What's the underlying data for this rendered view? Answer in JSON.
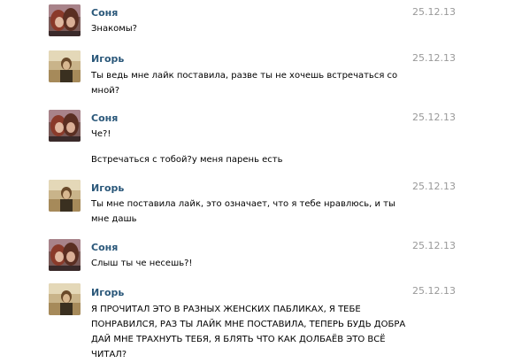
{
  "messages": [
    {
      "sender": "Соня",
      "date": "25.12.13",
      "avatar": "sonya",
      "lines": [
        "Знакомы?"
      ]
    },
    {
      "sender": "Игорь",
      "date": "25.12.13",
      "avatar": "igor",
      "lines": [
        "Ты ведь мне лайк поставила, разве ты не хочешь встречаться со",
        "мной?"
      ]
    },
    {
      "sender": "Соня",
      "date": "25.12.13",
      "avatar": "sonya",
      "lines": [
        "Че?!"
      ],
      "extra_lines": [
        "Встречаться с тобой?у меня парень есть"
      ]
    },
    {
      "sender": "Игорь",
      "date": "25.12.13",
      "avatar": "igor",
      "lines": [
        "Ты мне поставила лайк, это означает, что я тебе нравлюсь, и ты",
        "мне дашь"
      ]
    },
    {
      "sender": "Соня",
      "date": "25.12.13",
      "avatar": "sonya",
      "lines": [
        "Слыш ты че несешь?!"
      ]
    },
    {
      "sender": "Игорь",
      "date": "25.12.13",
      "avatar": "igor",
      "lines": [
        "Я ПРОЧИТАЛ ЭТО В РАЗНЫХ ЖЕНСКИХ ПАБЛИКАХ, Я ТЕБЕ",
        "ПОНРАВИЛСЯ, РАЗ ТЫ ЛАЙК МНЕ ПОСТАВИЛА, ТЕПЕРЬ БУДЬ ДОБРА",
        "ДАЙ МНЕ ТРАХНУТЬ ТЕБЯ, Я БЛЯТЬ ЧТО КАК ДОЛБАЁВ ЭТО ВСЁ",
        "ЧИТАЛ?"
      ]
    }
  ]
}
